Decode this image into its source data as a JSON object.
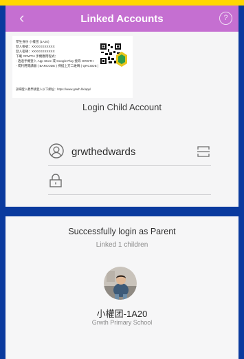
{
  "colors": {
    "background": "#0a3a9e",
    "accent_strip": "#ffd700",
    "navbar": "#c56fd1",
    "panel": "#f5f5f6"
  },
  "navbar": {
    "back_icon": "chevron-left-icon",
    "title": "Linked Accounts",
    "help_icon": "question-circle-icon"
  },
  "flyer": {
    "lines": [
      "學生身份  小權团 (1A20)",
      "登入帳號：XXXXXXXXXXX",
      "登入密碼：XXXXXXXXXXX",
      "下載 GRWTH 手機應用程式：",
      "- 透過手機登入 App Store 或 Google Play 搜尋 GRWTH",
      "- 或利用閱讀器 ( BARCODE ) 掃描上方二維碼 ( QRCODE )"
    ],
    "footer_line": "詳細登入教學請登入以下網址：https://www.grwth.hk/app/",
    "qr_icon": "qr-code-icon",
    "logo_icon": "grwth-logo-icon"
  },
  "login": {
    "section_title": "Login Child Account",
    "username_value": "grwthedwards",
    "user_icon": "user-circle-icon",
    "scan_icon": "scan-icon",
    "lock_icon": "lock-icon",
    "password_value": ""
  },
  "result": {
    "title": "Successfully login as Parent",
    "subtitle": "Linked 1 children",
    "child_name": "小權团-1A20",
    "school": "Grwth Primary School",
    "avatar_icon": "child-avatar-icon"
  }
}
